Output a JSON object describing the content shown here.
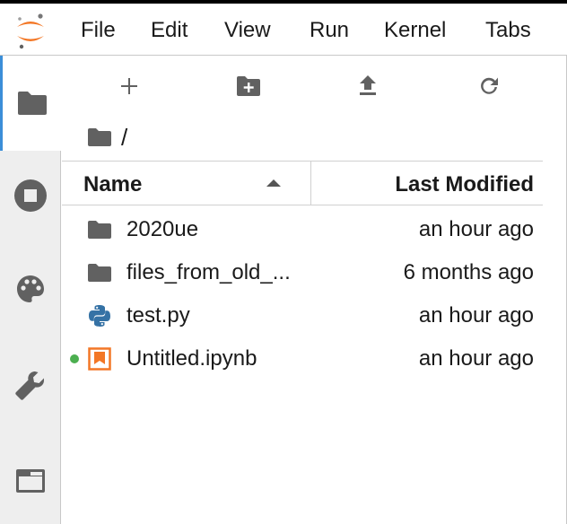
{
  "menu": {
    "items": [
      "File",
      "Edit",
      "View",
      "Run",
      "Kernel",
      "Tabs"
    ]
  },
  "sidebar": {
    "tabs": [
      {
        "icon": "folder-icon",
        "active": true
      },
      {
        "icon": "stop-circle-icon",
        "active": false
      },
      {
        "icon": "palette-icon",
        "active": false
      },
      {
        "icon": "wrench-icon",
        "active": false
      },
      {
        "icon": "tab-window-icon",
        "active": false
      }
    ]
  },
  "toolbar": {
    "buttons": [
      "add-icon",
      "new-folder-icon",
      "upload-icon",
      "refresh-icon"
    ]
  },
  "breadcrumb": {
    "path": "/"
  },
  "file_list": {
    "columns": {
      "name": "Name",
      "modified": "Last Modified"
    },
    "sort": "ascending",
    "rows": [
      {
        "name": "2020ue",
        "modified": "an hour ago",
        "type": "folder"
      },
      {
        "name": "files_from_old_...",
        "modified": "6 months ago",
        "type": "folder"
      },
      {
        "name": "test.py",
        "modified": "an hour ago",
        "type": "python"
      },
      {
        "name": "Untitled.ipynb",
        "modified": "an hour ago",
        "type": "notebook",
        "running": true
      }
    ]
  },
  "colors": {
    "accent": "#3b8ed8",
    "icon_gray": "#616161",
    "jupyter_orange": "#f37726",
    "python_blue": "#3572a5",
    "python_yellow": "#ffd43b",
    "running_green": "#4caf50"
  }
}
